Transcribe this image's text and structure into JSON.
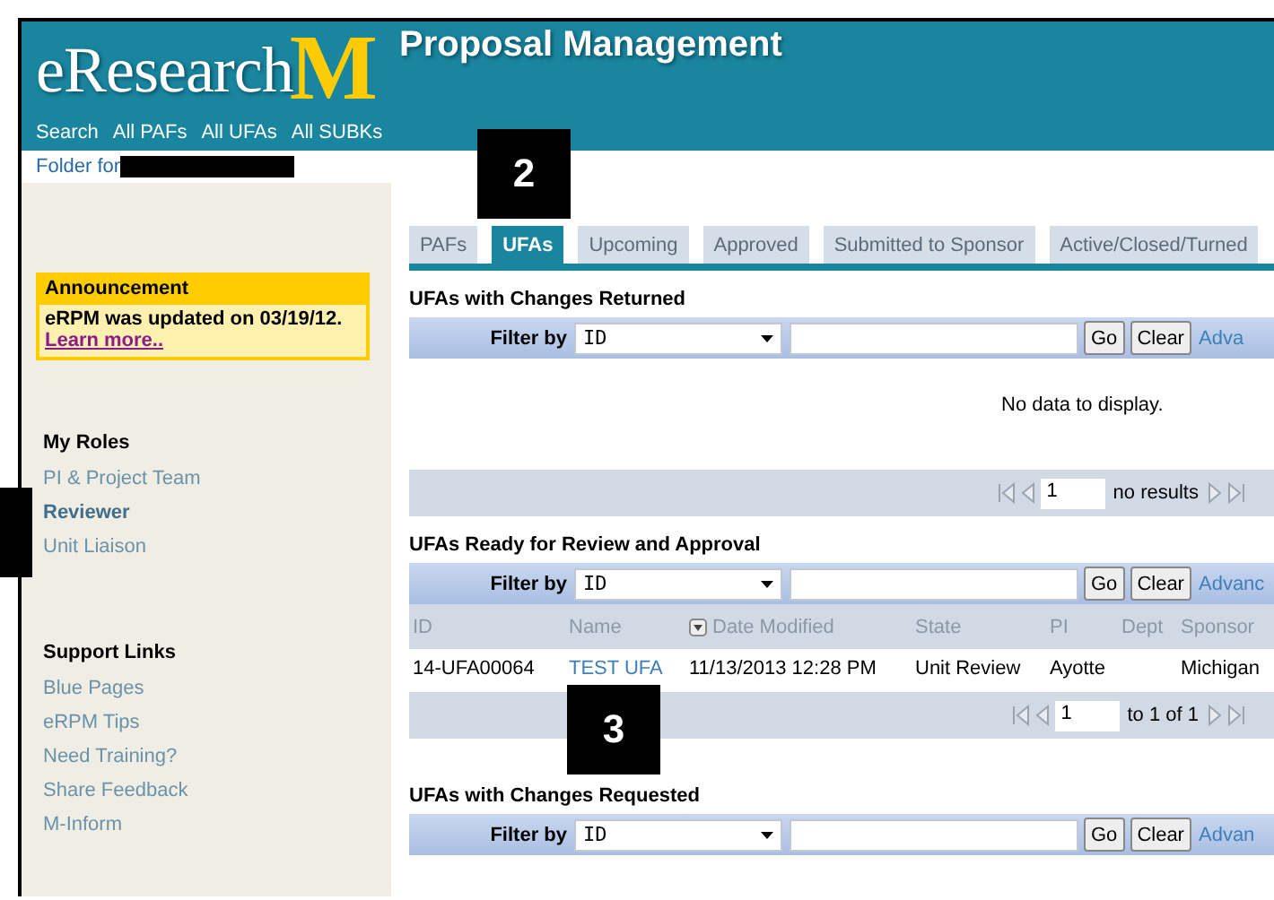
{
  "header": {
    "logo_text": "eResearch",
    "logo_letter": "M",
    "title": "Proposal Management",
    "nav": [
      "Search",
      "All PAFs",
      "All UFAs",
      "All SUBKs"
    ]
  },
  "folder": {
    "label": "Folder for"
  },
  "sidebar": {
    "announcement": {
      "title": "Announcement",
      "text": "eRPM  was updated on 03/19/12.",
      "link": "Learn more.."
    },
    "sections": [
      {
        "title": "My Roles",
        "items": [
          {
            "label": "PI & Project Team",
            "selected": false
          },
          {
            "label": "Reviewer",
            "selected": true
          },
          {
            "label": "Unit Liaison",
            "selected": false
          }
        ]
      },
      {
        "title": "Support Links",
        "items": [
          {
            "label": "Blue Pages",
            "selected": false
          },
          {
            "label": "eRPM Tips",
            "selected": false
          },
          {
            "label": "Need Training?",
            "selected": false
          },
          {
            "label": "Share Feedback",
            "selected": false
          },
          {
            "label": "M-Inform",
            "selected": false
          }
        ]
      }
    ]
  },
  "tabs": [
    {
      "label": "PAFs",
      "selected": false
    },
    {
      "label": "UFAs",
      "selected": true
    },
    {
      "label": "Upcoming",
      "selected": false
    },
    {
      "label": "Approved",
      "selected": false
    },
    {
      "label": "Submitted to Sponsor",
      "selected": false
    },
    {
      "label": "Active/Closed/Turned",
      "selected": false
    }
  ],
  "callouts": [
    "2",
    "3"
  ],
  "panels": [
    {
      "title": "UFAs with Changes Returned",
      "filter": {
        "label": "Filter by",
        "field": "ID",
        "go": "Go",
        "clear": "Clear",
        "advanced": "Adva"
      },
      "empty": "No data to display.",
      "pager": {
        "page": "1",
        "summary": "no results"
      }
    },
    {
      "title": "UFAs Ready for Review and Approval",
      "filter": {
        "label": "Filter by",
        "field": "ID",
        "go": "Go",
        "clear": "Clear",
        "advanced": "Advanc"
      },
      "columns": [
        "ID",
        "Name",
        "Date Modified",
        "State",
        "PI",
        "Dept",
        "Sponsor"
      ],
      "rows": [
        [
          "14-UFA00064",
          "TEST UFA",
          "11/13/2013 12:28 PM",
          "Unit Review",
          "Ayotte",
          "",
          "Michigan"
        ]
      ],
      "pager": {
        "page": "1",
        "summary": "to 1 of 1"
      }
    },
    {
      "title": "UFAs with Changes Requested",
      "filter": {
        "label": "Filter by",
        "field": "ID",
        "go": "Go",
        "clear": "Clear",
        "advanced": "Advan"
      }
    }
  ]
}
